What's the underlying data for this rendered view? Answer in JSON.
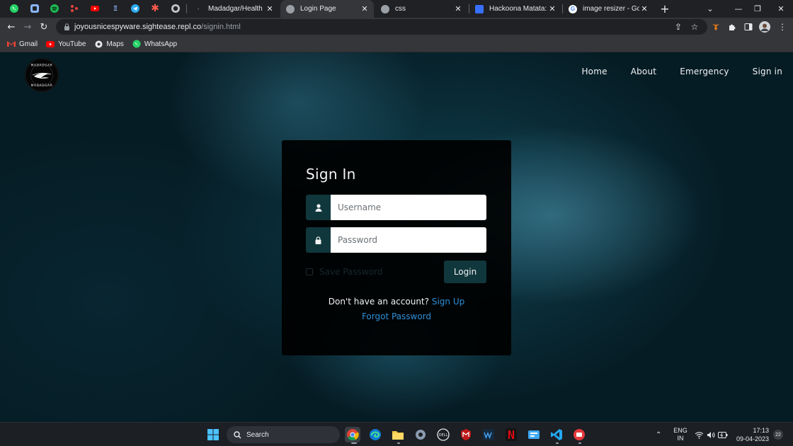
{
  "browser": {
    "pinned_tabs": [
      {
        "icon": "whatsapp-icon",
        "color": "#25d366"
      },
      {
        "icon": "generic-app-icon",
        "color": "#8ab4f8"
      },
      {
        "icon": "spotify-icon",
        "color": "#1db954"
      },
      {
        "icon": "cluster-icon",
        "color": "#e8453c"
      },
      {
        "icon": "youtube-icon",
        "color": "#ff0000"
      },
      {
        "icon": "e-icon",
        "color": "#8ab4f8"
      },
      {
        "icon": "telegram-icon",
        "color": "#2aabee"
      },
      {
        "icon": "asterisk-icon",
        "color": "#ff5a4b"
      },
      {
        "icon": "github-icon",
        "color": "#c5c5c5"
      }
    ],
    "tabs": [
      {
        "title": "Madadgar/Health",
        "active": false,
        "icon": "replit-icon"
      },
      {
        "title": "Login Page",
        "active": true,
        "icon": "globe-icon"
      },
      {
        "title": "css",
        "active": false,
        "icon": "globe-icon"
      },
      {
        "title": "Hackoona Matata: Da",
        "active": false,
        "icon": "devfolio-icon"
      },
      {
        "title": "image resizer - Googl",
        "active": false,
        "icon": "google-icon"
      }
    ],
    "new_tab_label": "+",
    "url_host": "joyousnicespyware.sightease.repl.co",
    "url_path": "/signin.html",
    "bookmarks": [
      {
        "label": "Gmail",
        "icon": "gmail-icon",
        "color": "#ea4335"
      },
      {
        "label": "YouTube",
        "icon": "youtube-icon",
        "color": "#ff0000"
      },
      {
        "label": "Maps",
        "icon": "maps-icon",
        "color": "#e8eaed"
      },
      {
        "label": "WhatsApp",
        "icon": "whatsapp-icon",
        "color": "#25d366"
      }
    ]
  },
  "site": {
    "logo_text": "MADADGAR",
    "nav": [
      {
        "label": "Home"
      },
      {
        "label": "About"
      },
      {
        "label": "Emergency"
      },
      {
        "label": "Sign in"
      }
    ]
  },
  "signin": {
    "title": "Sign In",
    "username_placeholder": "Username",
    "username_value": "",
    "password_placeholder": "Password",
    "password_value": "",
    "save_password_label": "Save Password",
    "save_password_checked": false,
    "login_label": "Login",
    "no_account_text": "Don't have an account?",
    "signup_label": "Sign Up",
    "forgot_label": "Forgot Password"
  },
  "taskbar": {
    "search_placeholder": "Search",
    "lang_top": "ENG",
    "lang_bottom": "IN",
    "time": "17:13",
    "date": "09-04-2023",
    "notification_count": "22"
  },
  "colors": {
    "accent": "#10373c",
    "link": "#2f8fd8",
    "page_bg": "#061c24"
  }
}
